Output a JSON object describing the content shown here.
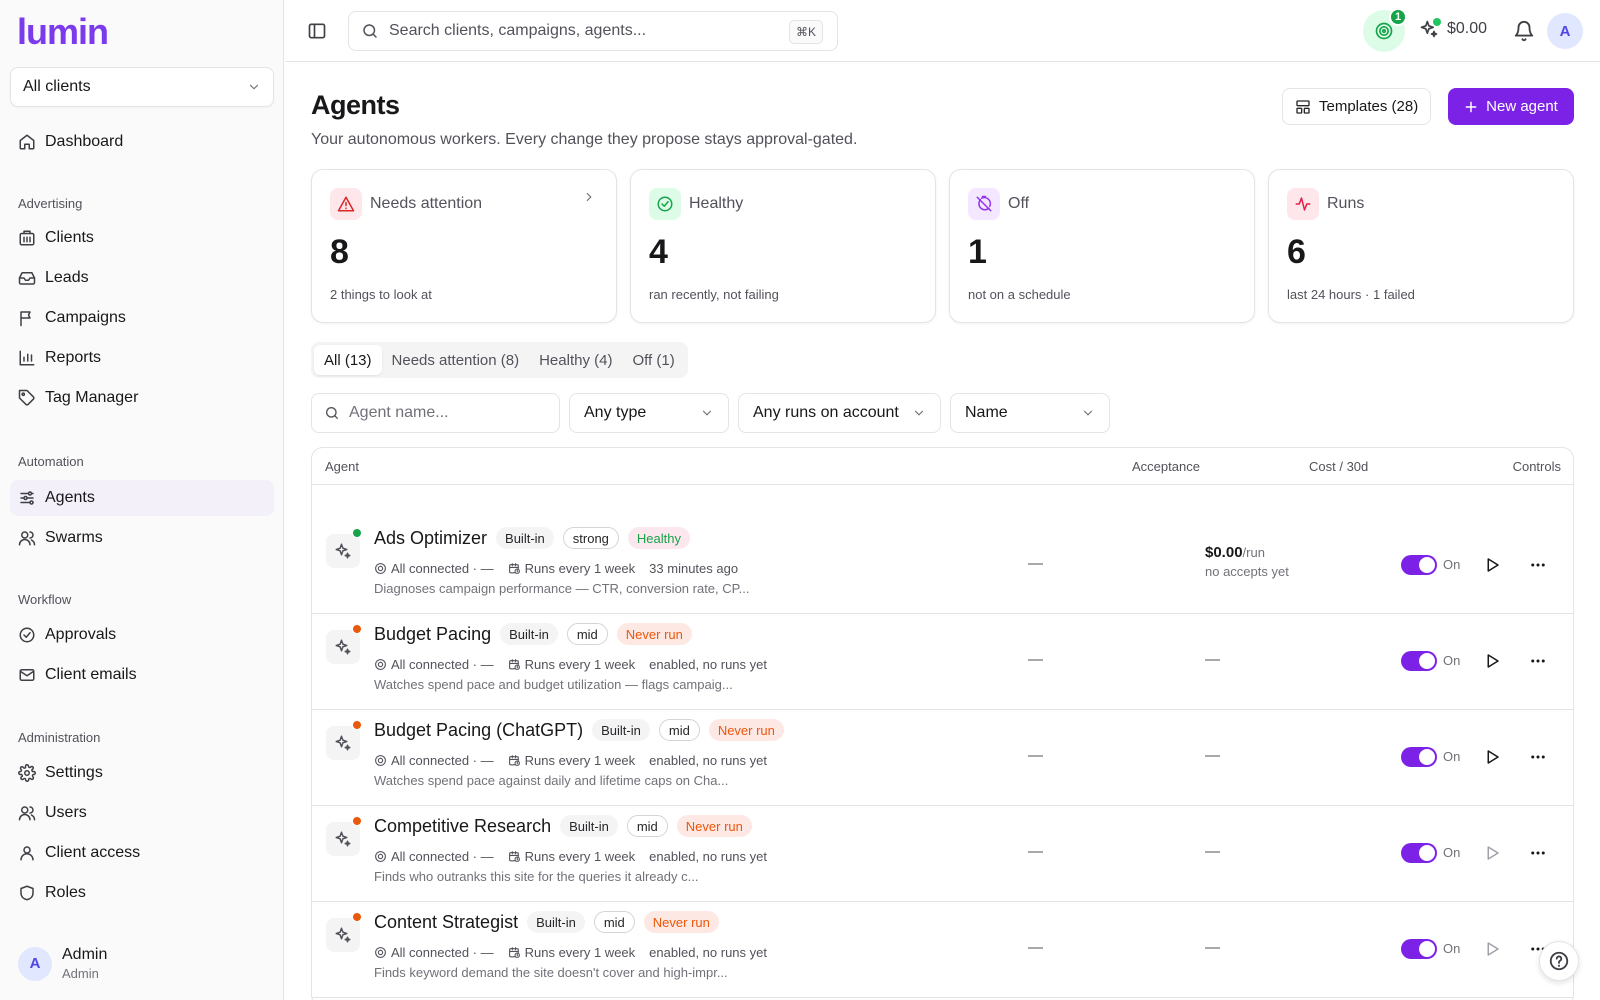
{
  "brand": {
    "logo_text": "lumin",
    "accent": "#7c22e6"
  },
  "sidebar": {
    "client_select": "All clients",
    "dashboard": "Dashboard",
    "sections": {
      "advertising": "Advertising",
      "automation": "Automation",
      "workflow": "Workflow",
      "administration": "Administration"
    },
    "items": {
      "clients": "Clients",
      "leads": "Leads",
      "campaigns": "Campaigns",
      "reports": "Reports",
      "tag_manager": "Tag Manager",
      "agents": "Agents",
      "swarms": "Swarms",
      "approvals": "Approvals",
      "client_emails": "Client emails",
      "settings": "Settings",
      "users": "Users",
      "client_access": "Client access",
      "roles": "Roles"
    },
    "user": {
      "initial": "A",
      "name": "Admin",
      "role": "Admin"
    }
  },
  "topbar": {
    "search_placeholder": "Search clients, campaigns, agents...",
    "shortcut": "⌘K",
    "goal_badge": "1",
    "credit": "$0.00",
    "avatar_initial": "A"
  },
  "page": {
    "title": "Agents",
    "subtitle": "Your autonomous workers. Every change they propose stays approval-gated.",
    "templates_button": "Templates (28)",
    "new_agent_button": "New agent"
  },
  "stats": [
    {
      "label": "Needs attention",
      "value": "8",
      "desc": "2 things to look at"
    },
    {
      "label": "Healthy",
      "value": "4",
      "desc": "ran recently, not failing"
    },
    {
      "label": "Off",
      "value": "1",
      "desc": "not on a schedule"
    },
    {
      "label": "Runs",
      "value": "6",
      "desc": "last 24 hours · 1 failed"
    }
  ],
  "tabs": [
    "All (13)",
    "Needs attention (8)",
    "Healthy (4)",
    "Off (1)"
  ],
  "filters": {
    "name_placeholder": "Agent name...",
    "type": "Any type",
    "runs": "Any runs on account",
    "sort": "Name"
  },
  "table": {
    "headers": {
      "agent": "Agent",
      "acceptance": "Acceptance",
      "cost": "Cost / 30d",
      "controls": "Controls"
    },
    "rows": [
      {
        "name": "Ads Optimizer",
        "builtin": "Built-in",
        "level": "strong",
        "status": "Healthy",
        "status_kind": "healthy",
        "connected": "All connected · —",
        "schedule": "Runs every 1 week",
        "last_run": "33 minutes ago",
        "desc": "Diagnoses campaign performance — CTR, conversion rate, CP...",
        "acceptance": "—",
        "cost_value": "$0.00",
        "cost_unit": "/run",
        "cost_sub": "no accepts yet",
        "cost": "",
        "toggle_label": "On",
        "dot_color": "#16a34a",
        "play_active": true
      },
      {
        "name": "Budget Pacing",
        "builtin": "Built-in",
        "level": "mid",
        "status": "Never run",
        "status_kind": "never",
        "connected": "All connected · —",
        "schedule": "Runs every 1 week",
        "last_run": "enabled, no runs yet",
        "desc": "Watches spend pace and budget utilization — flags campaig...",
        "acceptance": "—",
        "cost": "—",
        "toggle_label": "On",
        "dot_color": "#ea580c",
        "play_active": true
      },
      {
        "name": "Budget Pacing (ChatGPT)",
        "builtin": "Built-in",
        "level": "mid",
        "status": "Never run",
        "status_kind": "never",
        "connected": "All connected · —",
        "schedule": "Runs every 1 week",
        "last_run": "enabled, no runs yet",
        "desc": "Watches spend pace against daily and lifetime caps on Cha...",
        "acceptance": "—",
        "cost": "—",
        "toggle_label": "On",
        "dot_color": "#ea580c",
        "play_active": true
      },
      {
        "name": "Competitive Research",
        "builtin": "Built-in",
        "level": "mid",
        "status": "Never run",
        "status_kind": "never",
        "connected": "All connected · —",
        "schedule": "Runs every 1 week",
        "last_run": "enabled, no runs yet",
        "desc": "Finds who outranks this site for the queries it already c...",
        "acceptance": "—",
        "cost": "—",
        "toggle_label": "On",
        "dot_color": "#ea580c",
        "play_active": false
      },
      {
        "name": "Content Strategist",
        "builtin": "Built-in",
        "level": "mid",
        "status": "Never run",
        "status_kind": "never",
        "connected": "All connected · —",
        "schedule": "Runs every 1 week",
        "last_run": "enabled, no runs yet",
        "desc": "Finds keyword demand the site doesn't cover and high-impr...",
        "acceptance": "—",
        "cost": "—",
        "toggle_label": "On",
        "dot_color": "#ea580c",
        "play_active": false
      }
    ]
  }
}
